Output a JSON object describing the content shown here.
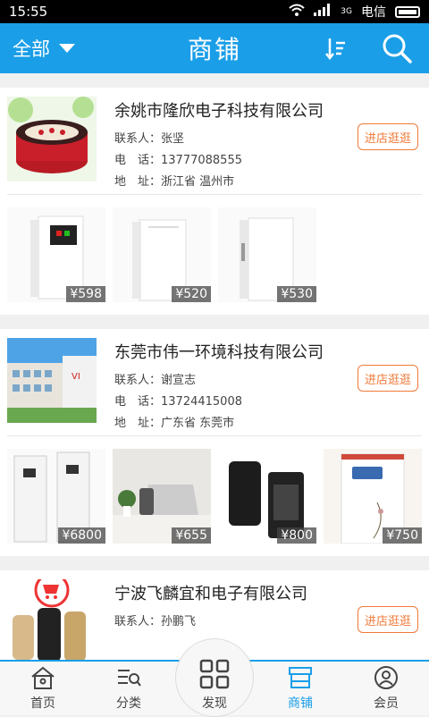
{
  "status": {
    "time": "15:55",
    "carrier": "电信",
    "net": "3G"
  },
  "header": {
    "scope": "全部",
    "title": "商铺"
  },
  "labels": {
    "contact": "联系人：",
    "phone": "电　话：",
    "address": "地　址：",
    "enter": "进店逛逛"
  },
  "shops": [
    {
      "name": "余姚市隆欣电子科技有限公司",
      "contact": "张坚",
      "phone": "13777088555",
      "address": "浙江省 温州市",
      "products": [
        {
          "price": "¥598"
        },
        {
          "price": "¥520"
        },
        {
          "price": "¥530"
        }
      ]
    },
    {
      "name": "东莞市伟一环境科技有限公司",
      "contact": "谢宣志",
      "phone": "13724415008",
      "address": "广东省 东莞市",
      "products": [
        {
          "price": "¥6800"
        },
        {
          "price": "¥655"
        },
        {
          "price": "¥800"
        },
        {
          "price": "¥750"
        }
      ]
    },
    {
      "name": "宁波飞麟宜和电子有限公司",
      "contact": "孙鹏飞",
      "phone": "",
      "address": ""
    }
  ],
  "tabs": [
    {
      "label": "首页",
      "icon": "home-icon"
    },
    {
      "label": "分类",
      "icon": "category-icon"
    },
    {
      "label": "发现",
      "icon": "grid-icon"
    },
    {
      "label": "商铺",
      "icon": "store-icon"
    },
    {
      "label": "会员",
      "icon": "user-icon"
    }
  ],
  "colors": {
    "accent": "#1a9ee8",
    "button": "#f07a3a"
  }
}
